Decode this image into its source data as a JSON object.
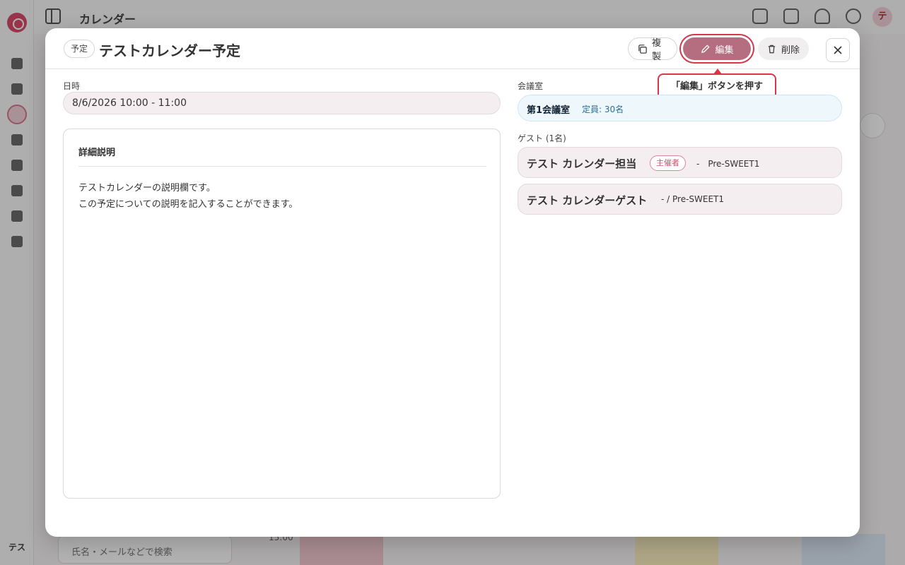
{
  "app": {
    "title": "カレンダー",
    "user_initial": "テス",
    "avatar_initial": "テ",
    "search_placeholder": "氏名・メールなどで検索",
    "time_label": "15:00"
  },
  "event": {
    "type_badge": "予定",
    "title": "テストカレンダー予定",
    "actions": {
      "duplicate_label": "複製",
      "edit_label": "編集",
      "delete_label": "削除"
    },
    "tooltip": "「編集」ボタンを押す",
    "datetime_label": "日時",
    "datetime_value": "8/6/2026 10:00 - 11:00",
    "description": {
      "heading": "詳細説明",
      "lines": [
        "テストカレンダーの説明欄です。",
        "この予定についての説明を記入することができます。"
      ]
    },
    "room": {
      "label": "会議室",
      "name": "第1会議室",
      "capacity": "定員: 30名"
    },
    "guests": {
      "label": "ゲスト (1名)",
      "items": [
        {
          "name": "テスト カレンダー担当",
          "badge": "主催者",
          "org": "-　Pre-SWEET1"
        },
        {
          "name": "テスト カレンダーゲスト",
          "org": "- / Pre-SWEET1"
        }
      ]
    }
  },
  "colors": {
    "accent": "#b56e80",
    "highlight": "#d8364b",
    "room_bg": "#eef7fc"
  }
}
